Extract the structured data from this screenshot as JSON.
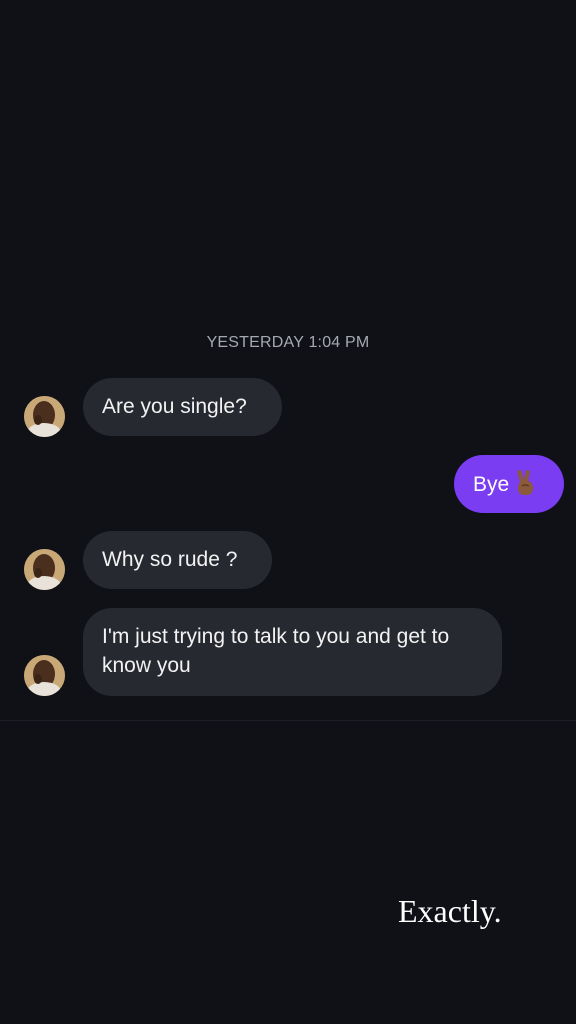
{
  "chat": {
    "timestamp": "YESTERDAY 1:04 PM",
    "messages": [
      {
        "sender": "other",
        "text": "Are you single?"
      },
      {
        "sender": "me",
        "text": "Bye",
        "emoji": "victory-hand-icon"
      },
      {
        "sender": "other",
        "text": "Why so rude ?"
      },
      {
        "sender": "other",
        "text": "I'm just trying to talk to you and get to know you"
      }
    ]
  },
  "caption": {
    "text": "Exactly."
  },
  "colors": {
    "background": "#0f1117",
    "received_bubble": "#272930",
    "sent_bubble": "#7a3df2",
    "timestamp": "#a6a9b0"
  }
}
